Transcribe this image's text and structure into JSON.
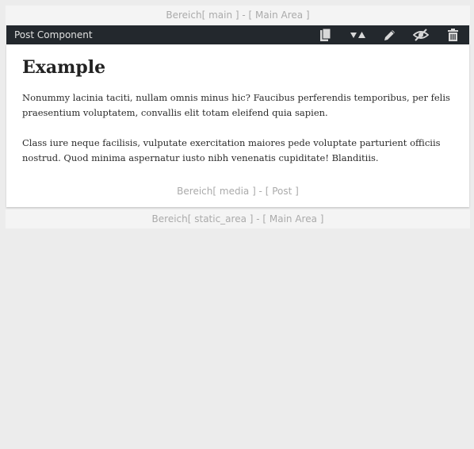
{
  "areas": {
    "main_label": "Bereich[ main ] - [ Main Area ]",
    "static_label": "Bereich[ static_area ] - [ Main Area ]"
  },
  "component": {
    "title": "Post Component",
    "toolbar_icons": [
      "copy-icon",
      "move-icon",
      "edit-icon",
      "hide-icon",
      "delete-icon"
    ],
    "toolbar_bg": "#23282d"
  },
  "post": {
    "heading": "Example",
    "paragraphs": [
      "Nonummy lacinia taciti, nullam omnis minus hic? Faucibus perferendis temporibus, per felis praesentium voluptatem, convallis elit totam eleifend quia sapien.",
      "Class iure neque facilisis, vulputate exercitation maiores pede voluptate parturient officiis nostrud. Quod minima aspernatur iusto nibh venenatis cupiditate! Blanditiis."
    ],
    "media_label": "Bereich[ media ] - [ Post ]"
  }
}
